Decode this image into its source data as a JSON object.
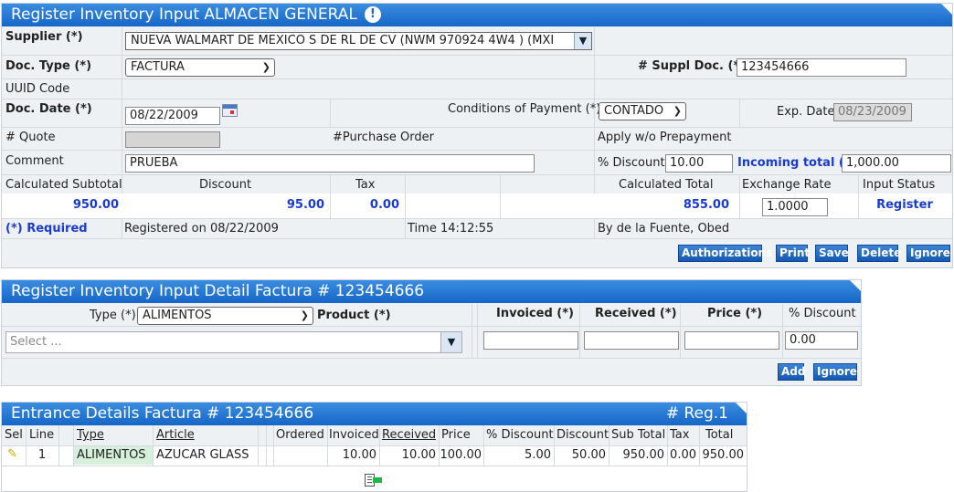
{
  "header": {
    "title": "Register Inventory Input ALMACEN GENERAL",
    "supplier_label": "Supplier (*)",
    "supplier_value": "NUEVA WALMART DE MEXICO S DE RL DE CV (NWM 970924 4W4 ) (MXI",
    "doc_type_label": "Doc. Type (*)",
    "doc_type_value": "FACTURA",
    "suppl_doc_label": "# Suppl Doc. (*)",
    "suppl_doc_value": "123454666",
    "uuid_label": "UUID Code",
    "doc_date_label": "Doc. Date (*)",
    "doc_date_value": "08/22/2009",
    "conditions_label": "Conditions of Payment (*)",
    "conditions_value": "CONTADO",
    "exp_date_label": "Exp. Date",
    "exp_date_value": "08/23/2009",
    "quote_label": "# Quote",
    "po_label": "#Purchase Order",
    "prepayment_label": "Apply w/o Prepayment",
    "comment_label": "Comment",
    "comment_value": "PRUEBA",
    "pct_discount_label": "% Discount",
    "pct_discount_value": "10.00",
    "incoming_total_label": "Incoming total (*)",
    "incoming_total_value": "1,000.00",
    "calc_subtotal_label": "Calculated Subtotal",
    "discount_label": "Discount",
    "tax_label": "Tax",
    "calc_total_label": "Calculated Total",
    "exchange_rate_label": "Exchange Rate",
    "input_status_label": "Input Status",
    "calc_subtotal_value": "950.00",
    "discount_value": "95.00",
    "tax_value": "0.00",
    "calc_total_value": "855.00",
    "exchange_rate_value": "1.0000",
    "input_status_value": "Register",
    "required_note": "(*) Required",
    "registered_on": "Registered on 08/22/2009",
    "time": "Time 14:12:55",
    "by": "By de la Fuente, Obed",
    "buttons": {
      "authorizations": "Authorizations",
      "print": "Print",
      "save": "Save",
      "delete": "Delete",
      "ignore": "Ignore"
    }
  },
  "detail": {
    "title": "Register Inventory Input Detail Factura # 123454666",
    "type_label": "Type (*)",
    "type_value": "ALIMENTOS",
    "product_label": "Product (*)",
    "product_placeholder": "Select ...",
    "invoiced_label": "Invoiced (*)",
    "received_label": "Received (*)",
    "price_label": "Price (*)",
    "pct_discount_label": "% Discount",
    "pct_discount_value": "0.00",
    "buttons": {
      "add": "Add",
      "ignore": "Ignore"
    }
  },
  "entrance": {
    "title": "Entrance Details Factura # 123454666",
    "reg_count": "# Reg.1",
    "columns": [
      "Sel",
      "Line",
      "Type",
      "Article",
      "Ordered",
      "Invoiced",
      "Received",
      "Price",
      "% Discount",
      "Discount",
      "Sub Total",
      "Tax",
      "Total"
    ],
    "rows": [
      {
        "line": "1",
        "type": "ALIMENTOS",
        "article": "AZUCAR GLASS",
        "ordered": "",
        "invoiced": "10.00",
        "received": "10.00",
        "price": "100.00",
        "pct_discount": "5.00",
        "discount": "50.00",
        "subtotal": "950.00",
        "tax": "0.00",
        "total": "950.00"
      }
    ]
  },
  "colors": {
    "header_blue": "#1666c8",
    "value_blue": "#1a3bd1",
    "panel_bg": "#eef1f4",
    "type_highlight": "#d6f0dc"
  }
}
